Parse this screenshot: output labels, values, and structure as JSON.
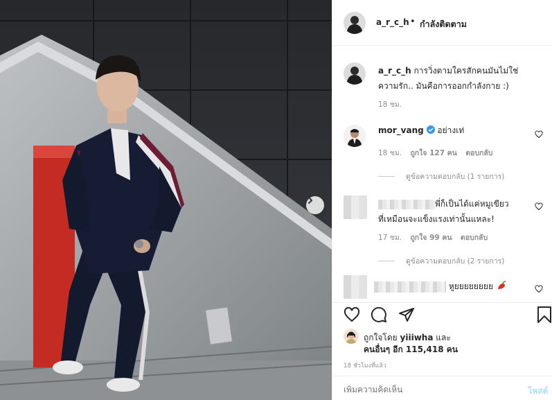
{
  "header": {
    "username": "a_r_c_h",
    "separator": "•",
    "follow_status": "กำลังติดตาม"
  },
  "caption": {
    "username": "a_r_c_h",
    "text": "การวิ่งตามใครสักคนมันไม่ใช่ความรัก.. มันคือการออกกำลังกาย :)",
    "time": "18 ชม."
  },
  "comments": [
    {
      "username": "mor_vang",
      "verified": true,
      "text": "อย่างเท่",
      "time": "18 ชม.",
      "likes": "ถูกใจ 127 คน",
      "reply": "ตอบกลับ",
      "view_replies": "ดูข้อความตอบกลับ (1 รายการ)"
    },
    {
      "username": "",
      "text_line1": "พี่ก็เป็นได้แค่หมูเขียว",
      "text_line2": "ที่เหมือนจะแข็งแรงเท่านั้นแหละ!",
      "time": "17 ชม.",
      "likes": "ถูกใจ 99 คน",
      "reply": "ตอบกลับ",
      "view_replies": "ดูข้อความตอบกลับ (2 รายการ)"
    },
    {
      "username": "",
      "text": "หูยยยยยยยย"
    }
  ],
  "likes": {
    "prefix": "ถูกใจโดย",
    "user": "yiiiwha",
    "and": "และ",
    "others": "คนอื่นๆ อีก 115,418 คน"
  },
  "posted_ago": "18 ชั่วโมงที่แล้ว",
  "add_comment": {
    "placeholder": "เพิ่มความคิดเห็น",
    "post_label": "โพสต์"
  },
  "icons": {
    "like": "heart-icon",
    "comment": "comment-icon",
    "share": "share-icon",
    "save": "bookmark-icon",
    "next": "chevron-right-icon"
  },
  "colors": {
    "verified": "#3897f0",
    "post_button": "#b2dffc",
    "meta_text": "#8e8e8e"
  }
}
